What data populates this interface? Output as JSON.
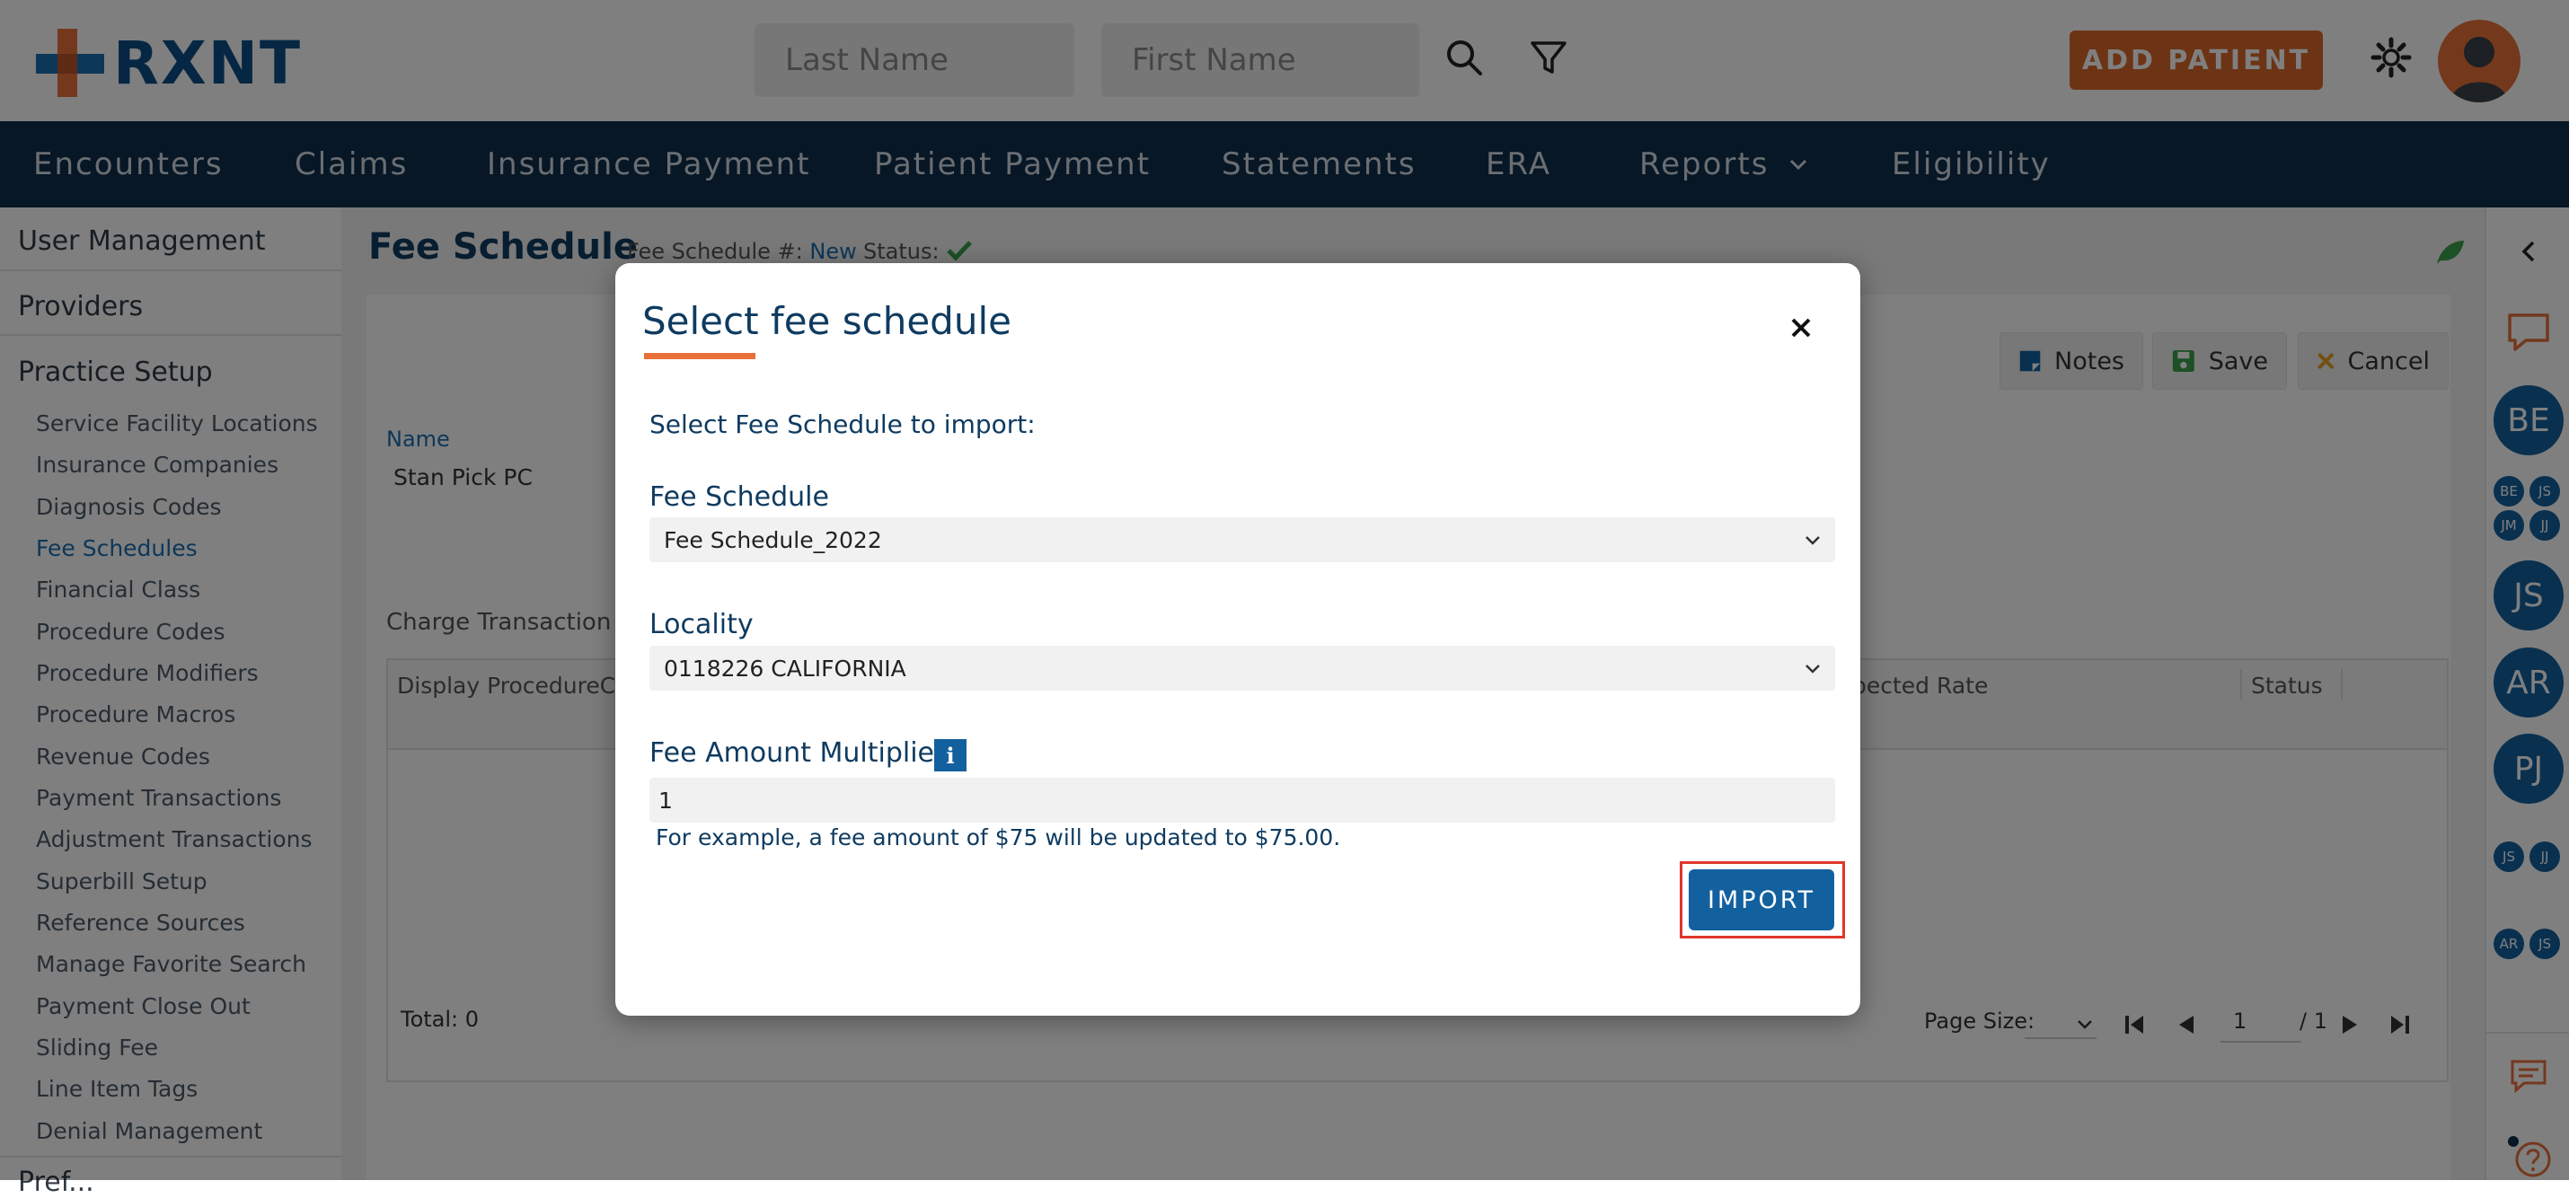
{
  "brand": {
    "name": "RXNT",
    "accent": "#e8703a",
    "primary": "#0f3b60"
  },
  "header": {
    "last_name_placeholder": "Last Name",
    "first_name_placeholder": "First Name",
    "add_patient_label": "ADD PATIENT",
    "icons": [
      "search-icon",
      "filter-icon",
      "gear-icon",
      "user-avatar"
    ]
  },
  "nav": {
    "items": [
      {
        "label": "Encounters"
      },
      {
        "label": "Claims"
      },
      {
        "label": "Insurance Payment"
      },
      {
        "label": "Patient Payment"
      },
      {
        "label": "Statements"
      },
      {
        "label": "ERA"
      },
      {
        "label": "Reports"
      },
      {
        "label": "Eligibility"
      }
    ]
  },
  "sidebar": {
    "headings": [
      "User Management",
      "Providers",
      "Practice Setup",
      "Pref..."
    ],
    "items": [
      {
        "label": "Service Facility Locations"
      },
      {
        "label": "Insurance Companies"
      },
      {
        "label": "Diagnosis Codes"
      },
      {
        "label": "Fee Schedules",
        "active": true
      },
      {
        "label": "Financial Class"
      },
      {
        "label": "Procedure Codes"
      },
      {
        "label": "Procedure Modifiers"
      },
      {
        "label": "Procedure Macros"
      },
      {
        "label": "Revenue Codes"
      },
      {
        "label": "Payment Transactions"
      },
      {
        "label": "Adjustment Transactions"
      },
      {
        "label": "Superbill Setup"
      },
      {
        "label": "Reference Sources"
      },
      {
        "label": "Manage Favorite Search"
      },
      {
        "label": "Payment Close Out"
      },
      {
        "label": "Sliding Fee"
      },
      {
        "label": "Line Item Tags"
      },
      {
        "label": "Denial Management"
      }
    ]
  },
  "page": {
    "title": "Fee Schedule",
    "fs_number_label": "Fee Schedule #:",
    "fs_number_value": "New",
    "status_label": "Status:",
    "toolbar": {
      "notes": "Notes",
      "save": "Save",
      "cancel": "Cancel"
    },
    "name_label": "Name",
    "name_value": "Stan Pick PC",
    "section_label": "Charge Transaction C",
    "grid_headers": [
      "Display ProcedureCod",
      "pected Rate",
      "Status"
    ],
    "total_label": "Total: 0",
    "pager": {
      "page_size_label": "Page Size:",
      "current_page": "1",
      "total_pages": "/ 1"
    }
  },
  "rail": {
    "bubbles": [
      "BE",
      "JS",
      "AR",
      "PJ"
    ],
    "mini_bubbles": [
      "BE",
      "JS",
      "JM",
      "JJ",
      "JS",
      "JJ",
      "AR",
      "JS"
    ]
  },
  "modal": {
    "title": "Select fee schedule",
    "subtitle": "Select Fee Schedule to import:",
    "fee_schedule_label": "Fee Schedule",
    "fee_schedule_value": "Fee Schedule_2022",
    "locality_label": "Locality",
    "locality_value": "0118226 CALIFORNIA",
    "multiplier_label": "Fee Amount Multiplier",
    "info_badge": "i",
    "multiplier_value": "1",
    "hint": "For example, a fee amount of $75 will be updated to $75.00.",
    "import_label": "IMPORT"
  }
}
